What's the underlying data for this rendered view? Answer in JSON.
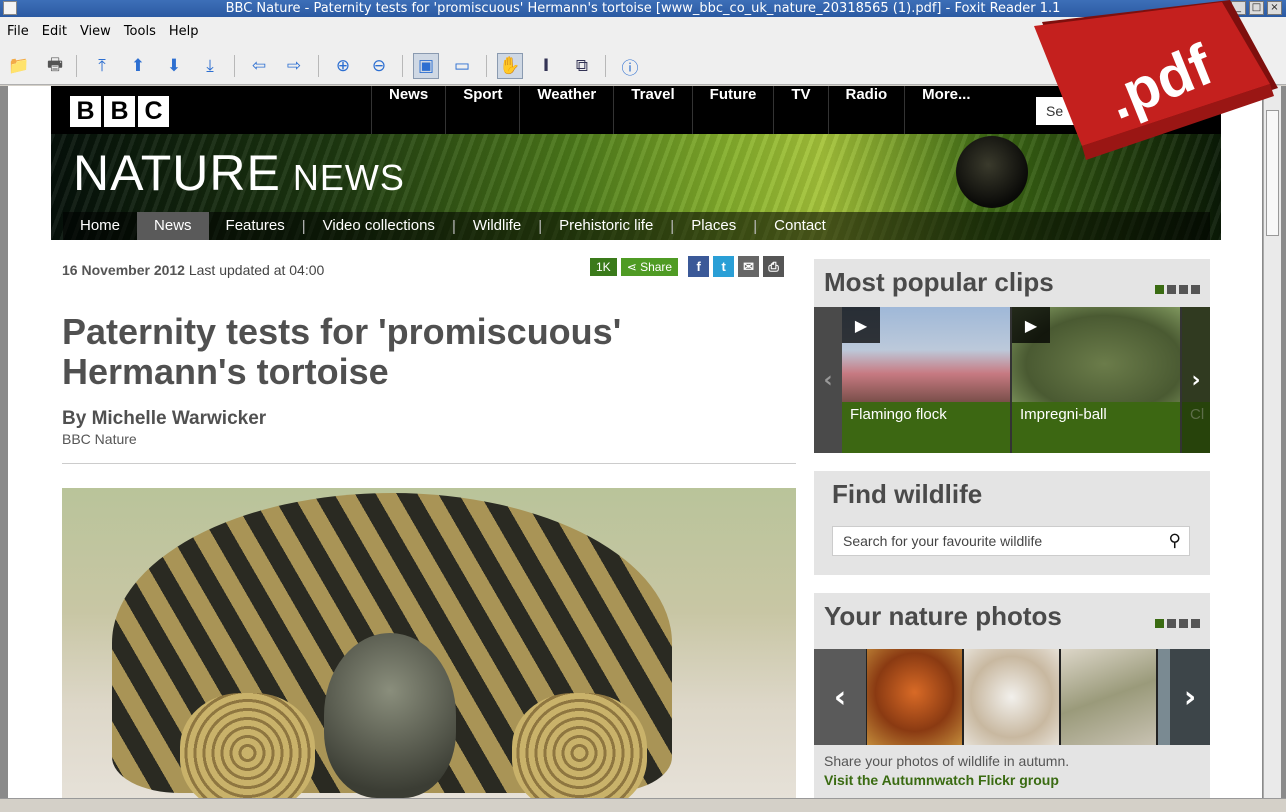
{
  "window": {
    "title": "BBC Nature - Paternity tests for 'promiscuous' Hermann's tortoise [www_bbc_co_uk_nature_20318565 (1).pdf] - Foxit Reader 1.1"
  },
  "menu": [
    "File",
    "Edit",
    "View",
    "Tools",
    "Help"
  ],
  "toolbar_icons": [
    "open-icon",
    "print-icon",
    "first-page-icon",
    "prev-page-icon",
    "next-page-icon",
    "last-page-icon",
    "back-icon",
    "forward-icon",
    "zoom-in-icon",
    "zoom-out-icon",
    "fit-page-icon",
    "fit-width-icon",
    "hand-tool-icon",
    "text-select-icon",
    "snapshot-icon",
    "info-icon"
  ],
  "bbc": {
    "logo": [
      "B",
      "B",
      "C"
    ],
    "nav": [
      "News",
      "Sport",
      "Weather",
      "Travel",
      "Future",
      "TV",
      "Radio",
      "More..."
    ],
    "search": "Se",
    "section_title": "NATURE",
    "section_sub": "NEWS",
    "subnav": [
      "Home",
      "News",
      "Features",
      "Video collections",
      "Wildlife",
      "Prehistoric life",
      "Places",
      "Contact"
    ]
  },
  "article": {
    "date": "16 November 2012",
    "updated": "Last updated at 04:00",
    "share_count": "1K",
    "share_label": "Share",
    "headline": "Paternity tests for 'promiscuous' Hermann's tortoise",
    "author": "By Michelle Warwicker",
    "source": "BBC Nature"
  },
  "sidebar": {
    "clips_title": "Most popular clips",
    "clips": [
      "Flamingo flock",
      "Impregni-ball",
      "Cl"
    ],
    "find_title": "Find wildlife",
    "find_placeholder": "Search for your favourite wildlife",
    "photos_title": "Your nature photos",
    "photos_caption": "Share your photos of wildlife in autumn.",
    "photos_link": "Visit the Autumnwatch Flickr group"
  },
  "badge": {
    "text": ".pdf"
  },
  "colors": {
    "bbc_green": "#3c6712",
    "title_blue": "#2b5aa2",
    "pdf_red": "#c4201e"
  }
}
